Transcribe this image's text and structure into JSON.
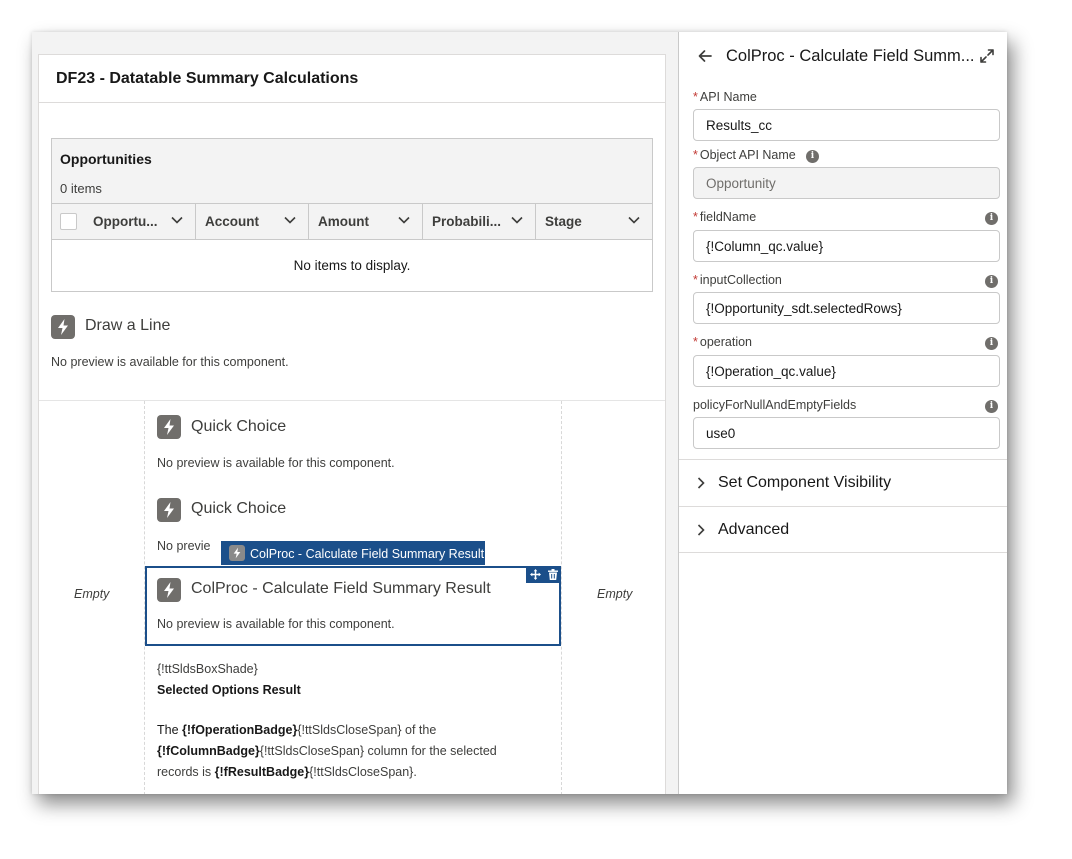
{
  "canvas": {
    "screen_title": "DF23 - Datatable Summary Calculations",
    "datatable": {
      "title": "Opportunities",
      "count": "0 items",
      "columns": [
        "Opportu...",
        "Account",
        "Amount",
        "Probabili...",
        "Stage"
      ],
      "empty_text": "No items to display."
    },
    "components": [
      {
        "name": "Draw a Line",
        "note": "No preview is available for this component."
      },
      {
        "name": "Quick Choice",
        "note": "No preview is available for this component."
      },
      {
        "name": "Quick Choice",
        "note": "No previe"
      },
      {
        "name": "ColProc - Calculate Field Summary Result",
        "note": "No preview is available for this component."
      }
    ],
    "empty_left": "Empty",
    "empty_right": "Empty",
    "selected_tag": "ColProc - Calculate Field Summary Result",
    "rich_text": {
      "line1": "{!ttSldsBoxShade}",
      "heading": "Selected Options Result",
      "p1_prefix": "The ",
      "p1_bold1": "{!fOperationBadge}",
      "p1_mid1": "{!ttSldsCloseSpan} of the",
      "p1_bold2": "{!fColumnBadge}",
      "p1_mid2": "{!ttSldsCloseSpan} column for the selected",
      "p1_mid3": "records is ",
      "p1_bold3": "{!fResultBadge}",
      "p1_suffix": "{!ttSldsCloseSpan}."
    }
  },
  "panel": {
    "title": "ColProc - Calculate Field Summ...",
    "fields": [
      {
        "label": "API Name",
        "required": "*",
        "value": "Results_cc"
      },
      {
        "label": "Object API Name",
        "required": "*",
        "value": "Opportunity"
      },
      {
        "label": "fieldName",
        "required": "*",
        "value": "{!Column_qc.value}"
      },
      {
        "label": "inputCollection",
        "required": "*",
        "value": "{!Opportunity_sdt.selectedRows}"
      },
      {
        "label": "operation",
        "required": "*",
        "value": "{!Operation_qc.value}"
      },
      {
        "label": "policyForNullAndEmptyFields",
        "required": "",
        "value": "use0"
      }
    ],
    "sections": [
      "Set Component Visibility",
      "Advanced"
    ],
    "info_glyph": "i"
  },
  "colors": {
    "accent": "#1b4f8a",
    "required": "#c23934",
    "icon_gray": "#706e6b"
  },
  "icons": {
    "component": "lightning-bolt-icon",
    "back": "arrow-left-icon",
    "expand": "expand-icon",
    "move": "move-icon",
    "delete": "trash-icon",
    "section": "chevron-right-icon",
    "column_sort": "chevron-down-icon"
  }
}
